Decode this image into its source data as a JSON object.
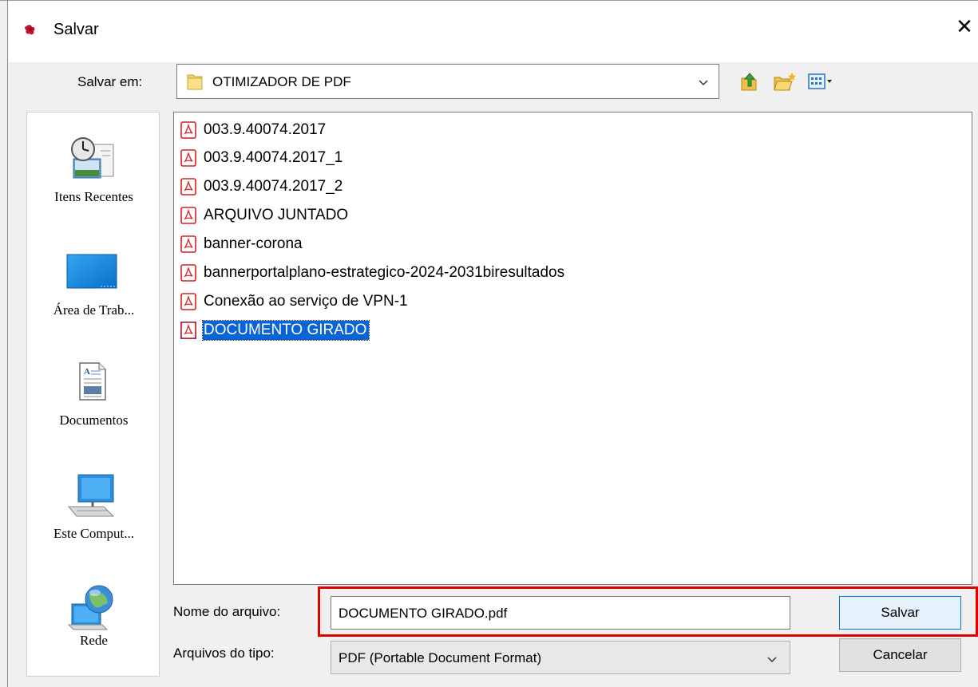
{
  "window": {
    "title": "Salvar",
    "close_glyph": "✕"
  },
  "toolbar": {
    "save_in_label": "Salvar em:",
    "current_folder": "OTIMIZADOR DE PDF",
    "icons": [
      "up-one-level-icon",
      "new-folder-icon",
      "view-menu-icon"
    ]
  },
  "places": [
    {
      "label": "Itens Recentes",
      "icon": "recent-items-icon"
    },
    {
      "label": "Área de Trab...",
      "icon": "desktop-icon"
    },
    {
      "label": "Documentos",
      "icon": "documents-icon"
    },
    {
      "label": "Este Comput...",
      "icon": "computer-icon"
    },
    {
      "label": "Rede",
      "icon": "network-icon"
    }
  ],
  "files": [
    "003.9.40074.2017",
    "003.9.40074.2017_1",
    "003.9.40074.2017_2",
    "ARQUIVO JUNTADO",
    "banner-corona",
    "bannerportalplano-estrategico-2024-2031biresultados",
    "Conexão ao serviço de VPN-1",
    "DOCUMENTO GIRADO"
  ],
  "selected_file": "DOCUMENTO GIRADO",
  "filename": {
    "label": "Nome do arquivo:",
    "value": "DOCUMENTO GIRADO.pdf"
  },
  "filetype": {
    "label": "Arquivos do tipo:",
    "value": "PDF (Portable Document Format)"
  },
  "buttons": {
    "save": "Salvar",
    "cancel": "Cancelar"
  },
  "colors": {
    "selection": "#0a64d8",
    "highlight_box": "#e00000",
    "pdf_icon": "#d81f1f"
  }
}
